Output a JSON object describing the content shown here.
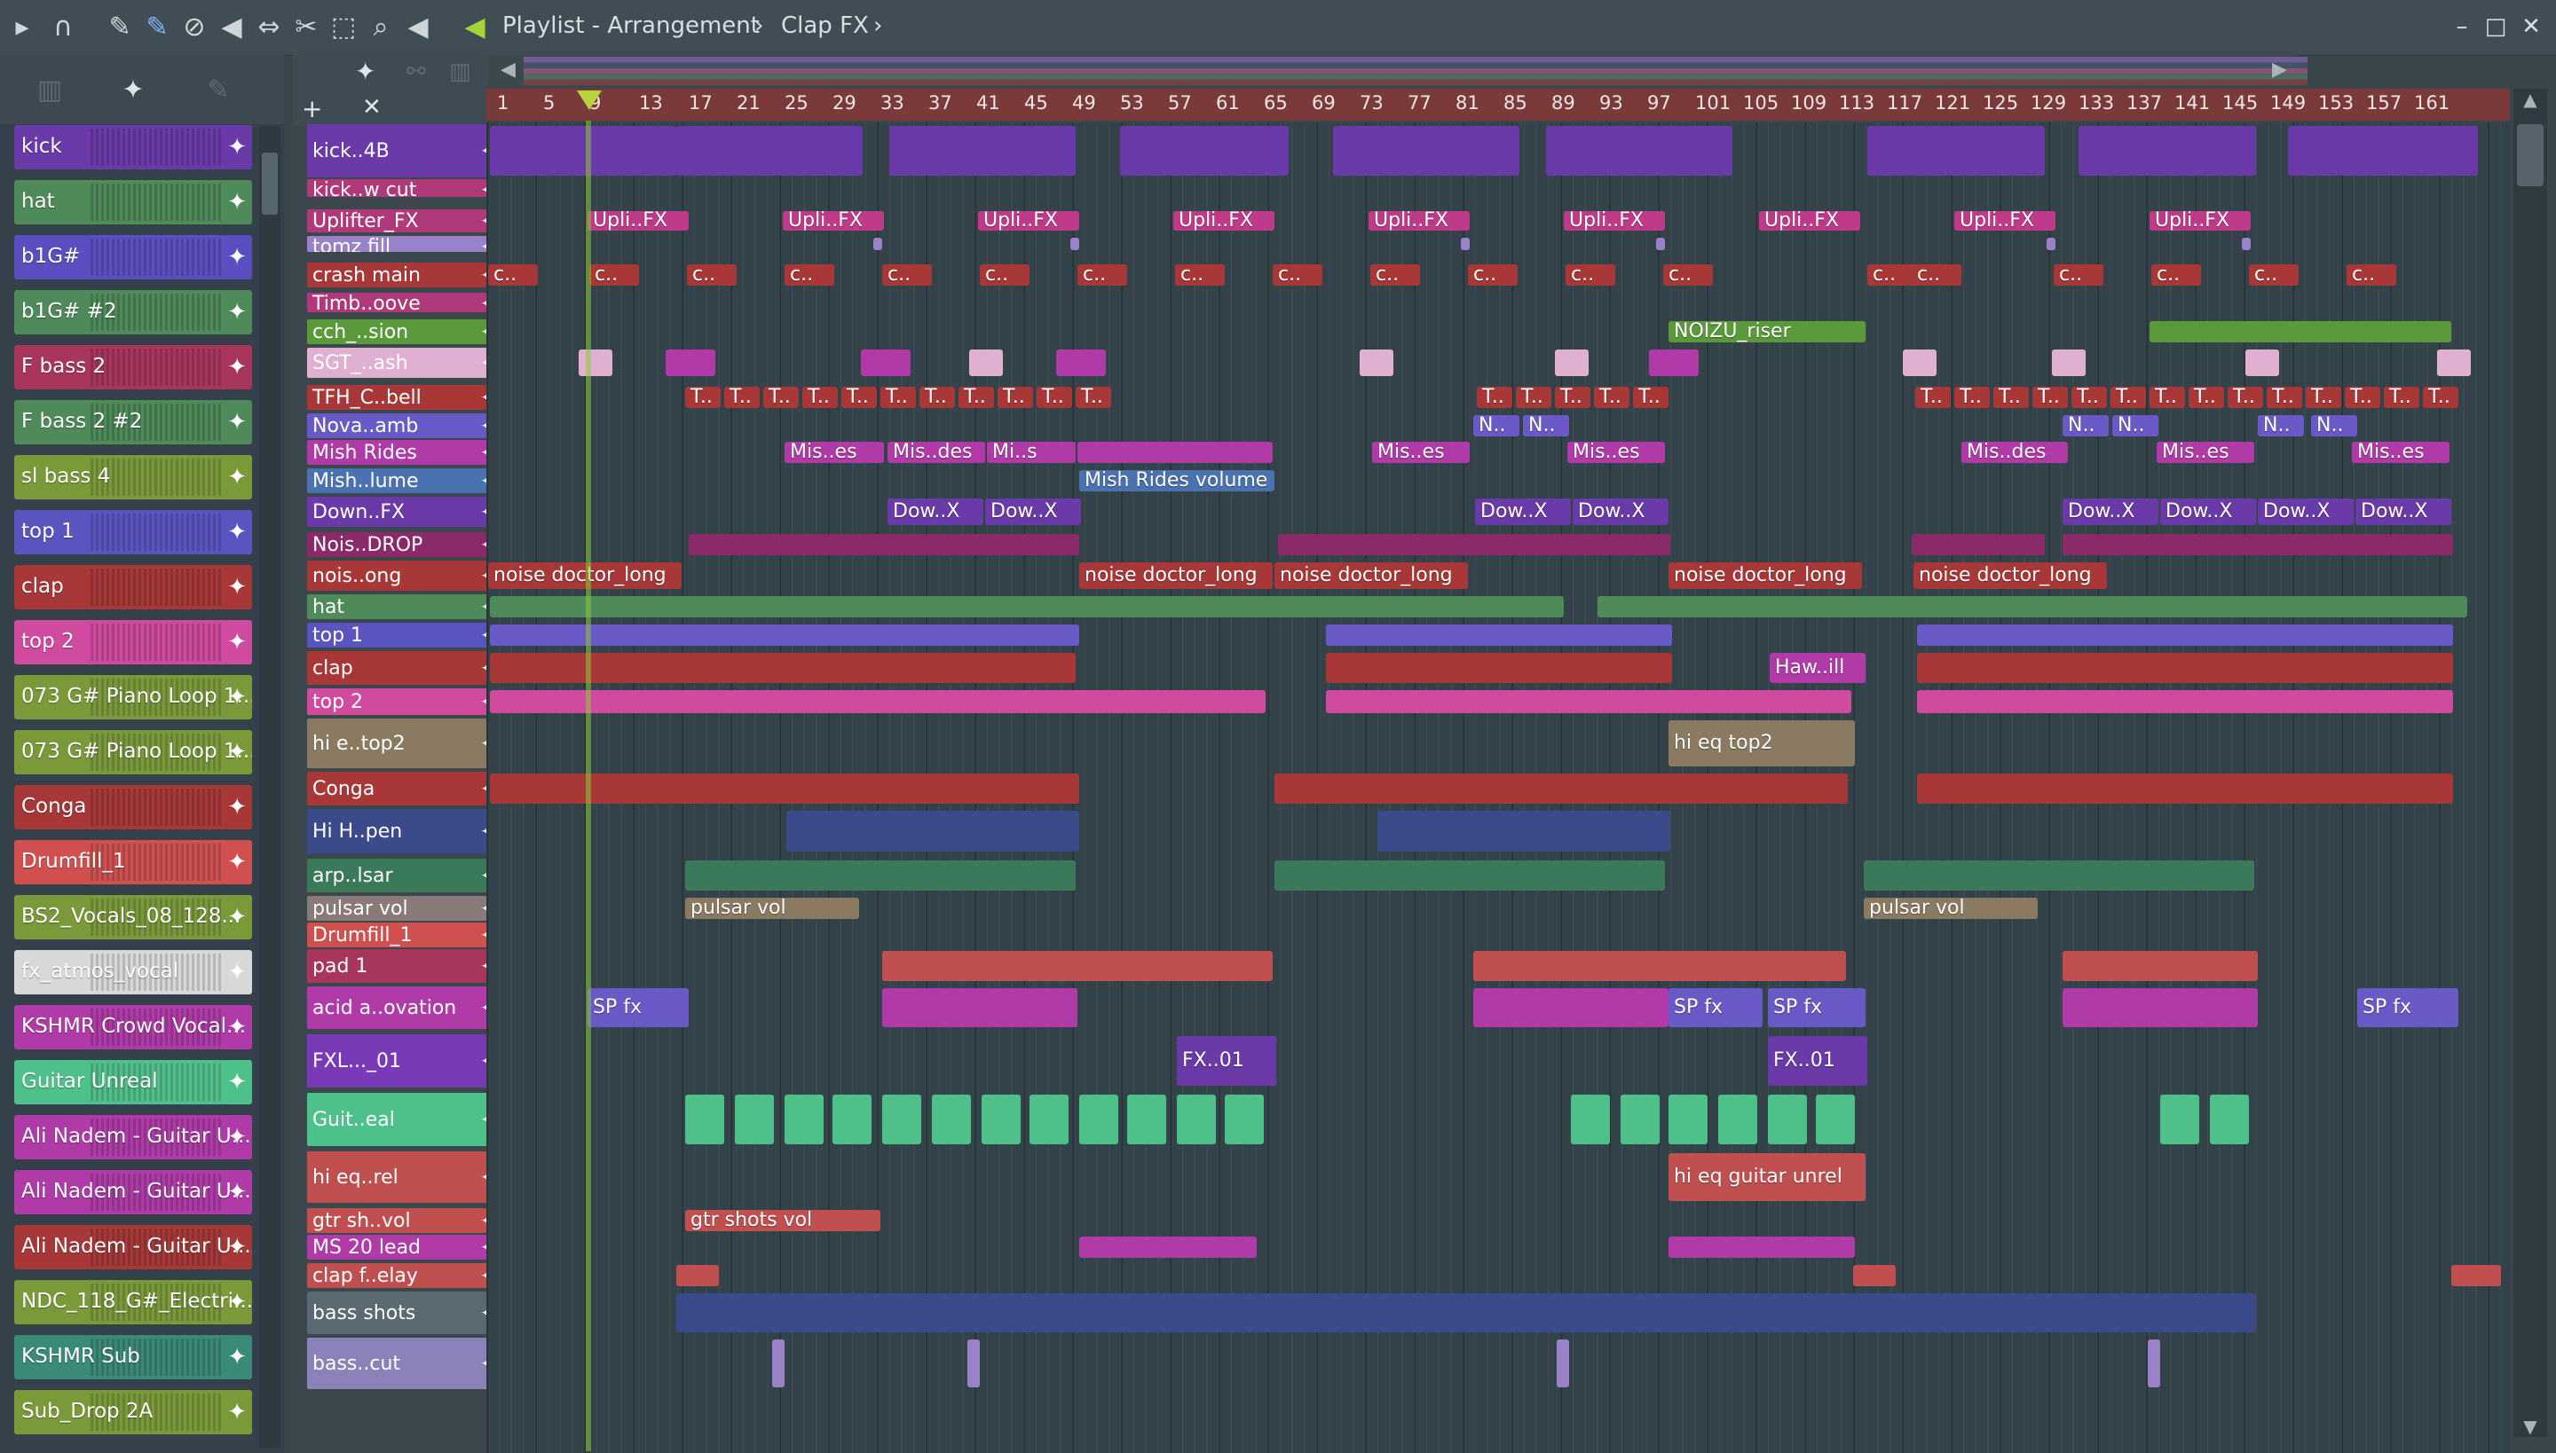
{
  "window": {
    "title": "Playlist - Arrangement",
    "separator": "›",
    "pattern": "Clap FX",
    "pattern_arrow": "›"
  },
  "toolbar_icons": [
    "play-icon",
    "magnet-icon",
    "pencil-icon",
    "paint-icon",
    "delete-icon",
    "mute-icon",
    "slip-icon",
    "slice-icon",
    "select-icon",
    "zoom-icon",
    "playback-icon"
  ],
  "window_buttons": [
    "–",
    "□",
    "✕"
  ],
  "track_header": {
    "add": "+",
    "close": "✕"
  },
  "ruler": {
    "ticks": [
      "1",
      "5",
      "9",
      "13",
      "17",
      "21",
      "25",
      "29",
      "33",
      "37",
      "41",
      "45",
      "49",
      "53",
      "57",
      "61",
      "65",
      "69",
      "73",
      "77",
      "81",
      "85",
      "89",
      "93",
      "97",
      "101",
      "105",
      "109",
      "113",
      "117",
      "121",
      "125",
      "129",
      "133",
      "137",
      "141",
      "145",
      "149",
      "153",
      "157",
      "161"
    ]
  },
  "channels": [
    {
      "name": "kick",
      "color": "#6a3aa8"
    },
    {
      "name": "hat",
      "color": "#4e8a5a"
    },
    {
      "name": "b1G#",
      "color": "#5a4ec0"
    },
    {
      "name": "b1G# #2",
      "color": "#4e8a5a"
    },
    {
      "name": "F bass 2",
      "color": "#a8365a"
    },
    {
      "name": "F bass 2 #2",
      "color": "#4e8a5a"
    },
    {
      "name": "sl bass 4",
      "color": "#7a9a3a"
    },
    {
      "name": "top 1",
      "color": "#5a54c0"
    },
    {
      "name": "clap",
      "color": "#a83838"
    },
    {
      "name": "top 2",
      "color": "#d04aa0"
    },
    {
      "name": "073 G# Piano Loop 1...",
      "color": "#7a9a3a"
    },
    {
      "name": "073 G# Piano Loop 1...",
      "color": "#7a9a3a"
    },
    {
      "name": "Conga",
      "color": "#a83838"
    },
    {
      "name": "Drumfill_1",
      "color": "#d05050"
    },
    {
      "name": "BS2_Vocals_08_128...",
      "color": "#7a9a3a"
    },
    {
      "name": "fx_atmos_vocal",
      "color": "#d8d8d8"
    },
    {
      "name": "KSHMR Crowd Vocal...",
      "color": "#b03aa8"
    },
    {
      "name": "Guitar Unreal",
      "color": "#4ec08a"
    },
    {
      "name": "Ali Nadem - Guitar U...",
      "color": "#b03aa8"
    },
    {
      "name": "Ali Nadem - Guitar U...",
      "color": "#b03aa8"
    },
    {
      "name": "Ali Nadem - Guitar U...",
      "color": "#a83838"
    },
    {
      "name": "NDC_118_G#_Electri...",
      "color": "#7a9a3a"
    },
    {
      "name": "KSHMR Sub",
      "color": "#3a8a7a"
    },
    {
      "name": "Sub_Drop 2A",
      "color": "#7a9a3a"
    }
  ],
  "tracks": [
    {
      "name": "kick..4B",
      "color": "#6a3aa8"
    },
    {
      "name": "kick..w cut",
      "color": "#b0397a"
    },
    {
      "name": "Uplifter_FX",
      "color": "#b0397a"
    },
    {
      "name": "tomz fill",
      "color": "#9a82c8"
    },
    {
      "name": "crash main",
      "color": "#a83838"
    },
    {
      "name": "Timb..oove",
      "color": "#b0397a"
    },
    {
      "name": "cch_..sion",
      "color": "#5a9a3a"
    },
    {
      "name": "SGT_..ash",
      "color": "#e0b0d0"
    },
    {
      "name": "TFH_C..bell",
      "color": "#a83838"
    },
    {
      "name": "Nova..amb",
      "color": "#6a5ac8"
    },
    {
      "name": "Mish Rides",
      "color": "#b03aa8"
    },
    {
      "name": "Mish..lume",
      "color": "#4a72b0"
    },
    {
      "name": "Down..FX",
      "color": "#6a3aa8"
    },
    {
      "name": "Nois..DROP",
      "color": "#8a2a68"
    },
    {
      "name": "nois..ong",
      "color": "#a83838"
    },
    {
      "name": "hat",
      "color": "#4e8a5a"
    },
    {
      "name": "top 1",
      "color": "#5a54c0"
    },
    {
      "name": "clap",
      "color": "#a83838"
    },
    {
      "name": "top 2",
      "color": "#d04aa0"
    },
    {
      "name": "hi e..top2",
      "color": "#8a7a62"
    },
    {
      "name": "Conga",
      "color": "#a83838"
    },
    {
      "name": "Hi H..pen",
      "color": "#3a4a8a"
    },
    {
      "name": "arp..lsar",
      "color": "#3a7a5a"
    },
    {
      "name": "pulsar vol",
      "color": "#8a7a7a"
    },
    {
      "name": "Drumfill_1",
      "color": "#d05050"
    },
    {
      "name": "pad 1",
      "color": "#a8365a"
    },
    {
      "name": "acid a..ovation",
      "color": "#b03aa8"
    },
    {
      "name": "FXL..._01",
      "color": "#7a3ab8"
    },
    {
      "name": "Guit..eal",
      "color": "#4ec08a"
    },
    {
      "name": "hi eq..rel",
      "color": "#c05050"
    },
    {
      "name": "gtr sh..vol",
      "color": "#c05050"
    },
    {
      "name": "MS 20 lead",
      "color": "#b03aa8"
    },
    {
      "name": "clap f..elay",
      "color": "#c05050"
    },
    {
      "name": "bass shots",
      "color": "#5a6a72"
    },
    {
      "name": "bass..cut",
      "color": "#8a82b8"
    }
  ],
  "clip_labels": {
    "uplifter": "Upli..FX",
    "crash": "c..",
    "noizu": "NOIZU_riser",
    "tfh": "T..",
    "nova": "N..",
    "mish_es": "Mis..es",
    "mish_des": "Mis..des",
    "mish_s": "Mi..s",
    "mish_vol": "Mish Rides volume",
    "downfx": "Dow..X",
    "noise": "noise doctor_long",
    "haw": "Haw..ill",
    "hieq": "hi eq top2",
    "pulsar": "pulsar vol",
    "spfx": "SP fx",
    "fx01": "FX..01",
    "higtr": "hi eq guitar unrel",
    "gtrshots": "gtr shots vol"
  }
}
